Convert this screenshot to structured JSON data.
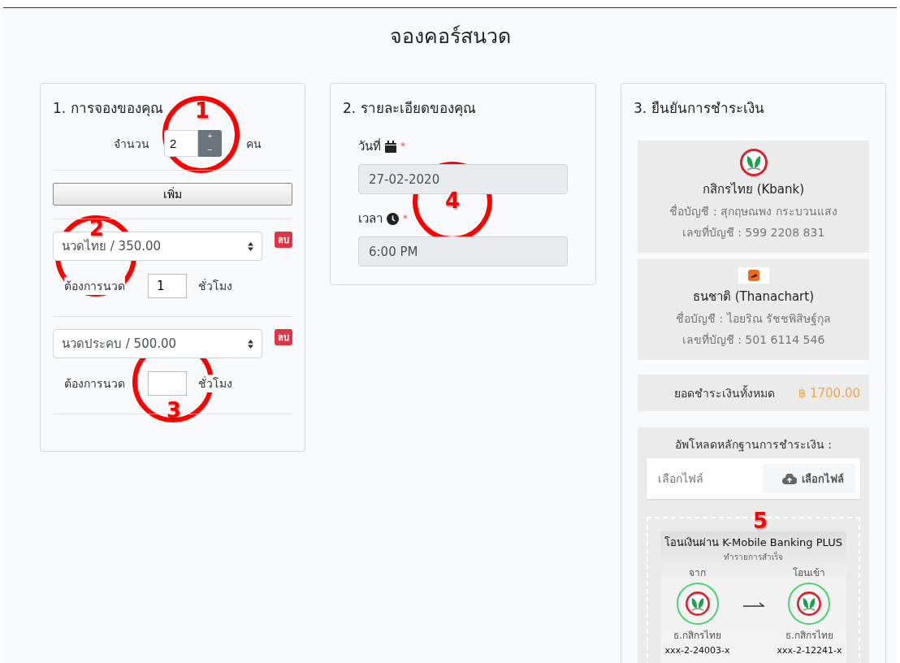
{
  "page_title": "จองคอร์สนวด",
  "booking": {
    "title": "1. การจองของคุณ",
    "people": {
      "label": "จำนวน",
      "value": "2",
      "plus": "+",
      "minus": "−",
      "unit": "คน"
    },
    "add_button": "เพิ่ม",
    "items": [
      {
        "service": "นวดไทย / 350.00",
        "delete": "ลบ",
        "hours_label": "ต้องการนวด",
        "hours": "1",
        "unit": "ชั่วโมง"
      },
      {
        "service": "นวดประคบ / 500.00",
        "delete": "ลบ",
        "hours_label": "ต้องการนวด",
        "unit": "ชั่วโมง"
      }
    ]
  },
  "details": {
    "title": "2. รายละเอียดของคุณ",
    "fields": [
      {
        "kind": "date",
        "label": "วันที่",
        "required": "*",
        "value": "27-02-2020"
      },
      {
        "kind": "time",
        "label": "เวลา",
        "required": "*",
        "value": "6:00 PM"
      }
    ]
  },
  "payment": {
    "title": "3. ยืนยันการชำระเงิน",
    "banks": [
      {
        "kind": "kbank",
        "name": "กสิกรไทย (Kbank)",
        "account_name": "ชื่อบัญชี : สุกฤษณพง กระบวนแสง",
        "account_no": "เลขที่บัญชี : 599 2208 831"
      },
      {
        "kind": "thanachart",
        "name": "ธนชาติ (Thanachart)",
        "account_name": "ชื่อบัญชี : ไอยริณ รัชชพิสิษฐ์กุล",
        "account_no": "เลขที่บัญชี : 501 6114 546"
      }
    ],
    "total_label": "ยอดชำระเงินทั้งหมด",
    "total": "฿ 1700.00",
    "upload": {
      "label": "อัพโหลดหลักฐานการชำระเงิน :",
      "file_placeholder": "เลือกไฟล์",
      "browse": "เลือกไฟล์"
    },
    "slip": {
      "title": "โอนเงินผ่าน K-Mobile Banking PLUS",
      "status": "ทำรายการสำเร็จ",
      "from_label": "จาก",
      "to_label": "โอนเข้า",
      "from_bank": "ธ.กสิกรไทย",
      "from_account": "xxx-2-24003-x",
      "to_bank": "ธ.กสิกรไทย",
      "to_account": "xxx-2-12241-x"
    }
  },
  "annotations": [
    "1",
    "2",
    "3",
    "4",
    "5"
  ]
}
